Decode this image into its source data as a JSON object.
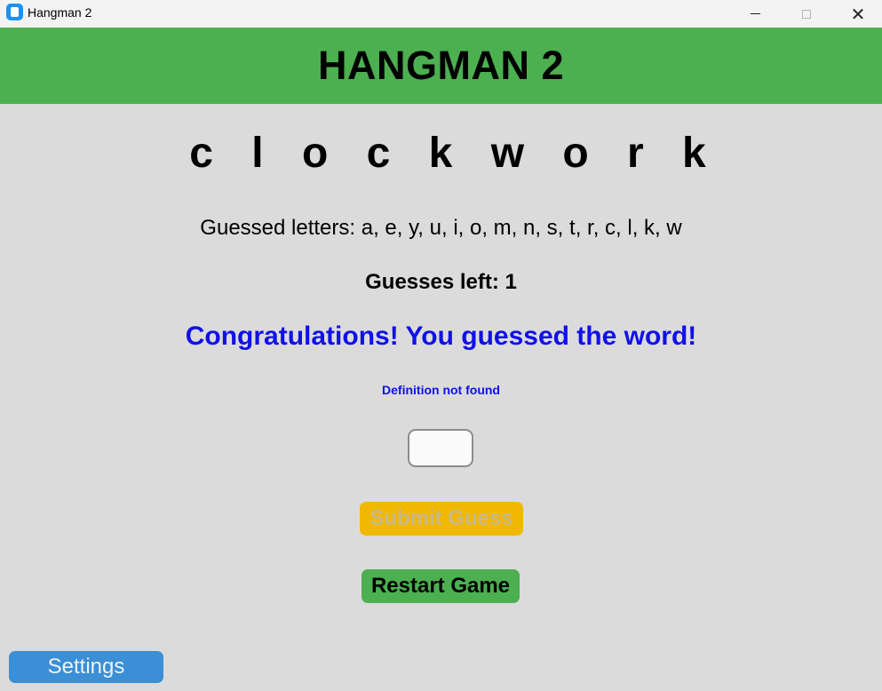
{
  "window": {
    "title": "Hangman 2",
    "icon": "app-icon",
    "controls": {
      "minimize_icon": "minimize-icon",
      "maximize_icon": "maximize-icon",
      "close_icon": "close-icon",
      "close_glyph": "✕"
    }
  },
  "header": {
    "title": "HANGMAN 2",
    "color": "#4caf50"
  },
  "game": {
    "word_display": "c l o c k w o r k",
    "guessed_letters": "Guessed letters: a, e, y, u, i, o, m, n, s, t, r, c, l, k, w",
    "guesses_left": "Guesses left: 1",
    "status_message": "Congratulations! You guessed the word!",
    "definition": "Definition not found",
    "status_color": "#1010e8"
  },
  "input": {
    "value": ""
  },
  "buttons": {
    "submit_label": "Submit Guess",
    "submit_color": "#f0b800",
    "restart_label": "Restart Game",
    "restart_color": "#4caf50",
    "settings_label": "Settings",
    "settings_color": "#3a8fd6"
  }
}
